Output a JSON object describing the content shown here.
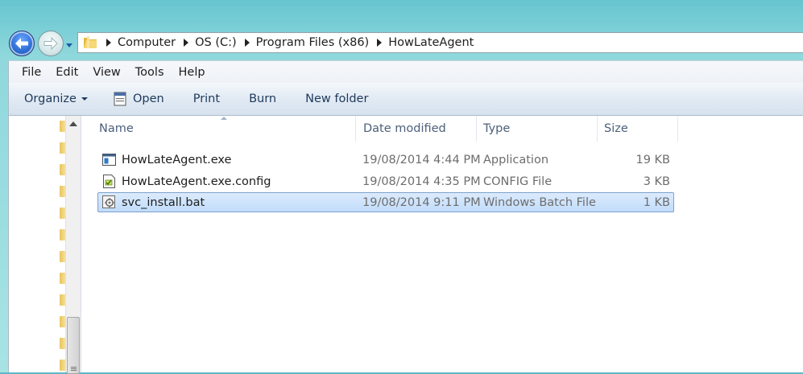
{
  "address": {
    "crumbs": [
      "Computer",
      "OS (C:)",
      "Program Files (x86)",
      "HowLateAgent"
    ]
  },
  "menu": {
    "items": [
      "File",
      "Edit",
      "View",
      "Tools",
      "Help"
    ]
  },
  "toolbar": {
    "organize": "Organize",
    "open": "Open",
    "print": "Print",
    "burn": "Burn",
    "new_folder": "New folder"
  },
  "columns": {
    "name": "Name",
    "date": "Date modified",
    "type": "Type",
    "size": "Size"
  },
  "files": [
    {
      "name": "HowLateAgent.exe",
      "date": "19/08/2014 4:44 PM",
      "type": "Application",
      "size": "19 KB",
      "icon": "application-icon",
      "selected": false
    },
    {
      "name": "HowLateAgent.exe.config",
      "date": "19/08/2014 4:35 PM",
      "type": "CONFIG File",
      "size": "3 KB",
      "icon": "config-file-icon",
      "selected": false
    },
    {
      "name": "svc_install.bat",
      "date": "19/08/2014 9:11 PM",
      "type": "Windows Batch File",
      "size": "1 KB",
      "icon": "batch-file-icon",
      "selected": true
    }
  ]
}
